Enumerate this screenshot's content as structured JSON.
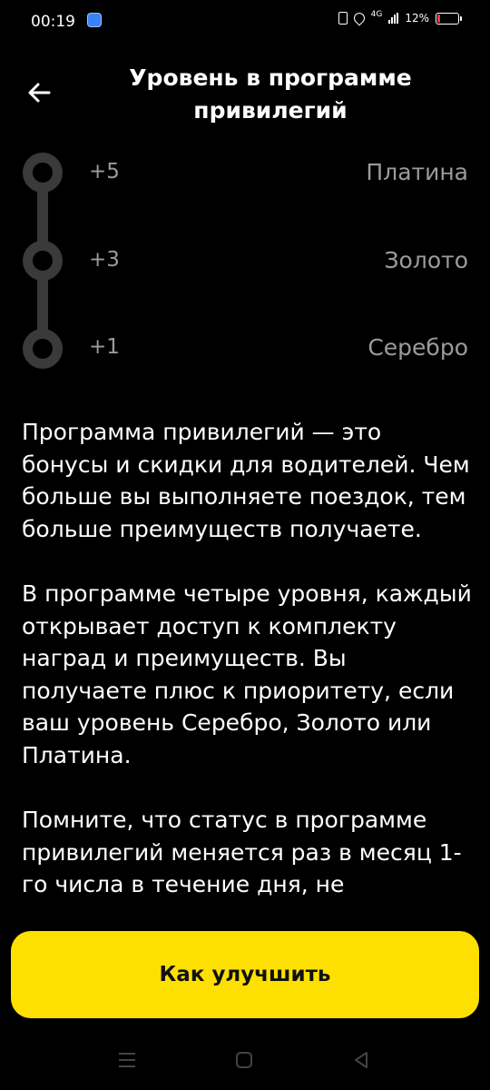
{
  "status_bar": {
    "time": "00:19",
    "network": "4G",
    "battery_percent": "12%",
    "battery_level": 0.12,
    "battery_color": "#ff3b30"
  },
  "header": {
    "title": "Уровень в программе привилегий",
    "back_icon": "arrow-left-icon"
  },
  "levels": [
    {
      "points": "+5",
      "name": "Платина"
    },
    {
      "points": "+3",
      "name": "Золото"
    },
    {
      "points": "+1",
      "name": "Серебро"
    }
  ],
  "description": {
    "paragraphs": [
      "Программа привилегий — это бонусы и скидки для водителей. Чем больше вы выполняете поездок, тем больше преимуществ получаете.",
      "В программе четыре уровня, каждый открывает доступ к комплекту наград и преимуществ. Вы получаете плюс к приоритету, если ваш уровень Серебро, Золото или Платина.",
      "Помните, что статус в программе привилегий меняется раз в месяц 1-го числа в течение дня, не"
    ]
  },
  "cta": {
    "label": "Как улучшить",
    "color": "#fde000"
  },
  "nav_bar": {
    "icons": [
      "menu-icon",
      "home-icon",
      "back-triangle-icon"
    ]
  }
}
